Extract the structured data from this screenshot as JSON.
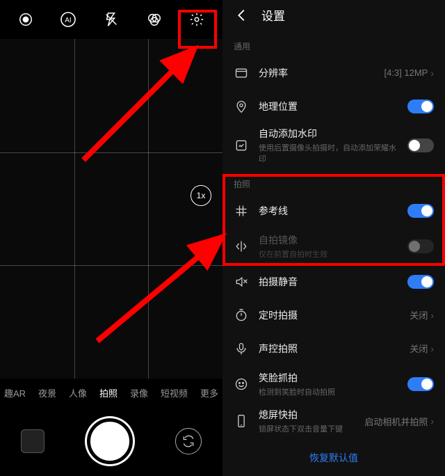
{
  "camera": {
    "zoom_label": "1x",
    "modes": [
      "趣AR",
      "夜景",
      "人像",
      "拍照",
      "录像",
      "短视频",
      "更多"
    ],
    "active_mode_index": 3
  },
  "settings": {
    "title": "设置",
    "sections": {
      "general_label": "通用",
      "photo_label": "拍照"
    },
    "rows": {
      "resolution": {
        "label": "分辨率",
        "value": "[4:3] 12MP"
      },
      "location": {
        "label": "地理位置",
        "on": true
      },
      "watermark": {
        "label": "自动添加水印",
        "sub": "使用后置摄像头拍摄时，自动添加荣耀水印",
        "on": false
      },
      "gridlines": {
        "label": "参考线",
        "on": true
      },
      "mirror": {
        "label": "自拍镜像",
        "sub": "仅在前置自拍时生效",
        "on": false
      },
      "mute": {
        "label": "拍摄静音",
        "on": true
      },
      "timer": {
        "label": "定时拍摄",
        "value": "关闭"
      },
      "voice": {
        "label": "声控拍照",
        "value": "关闭"
      },
      "smile": {
        "label": "笑脸抓拍",
        "sub": "检测到笑脸时自动拍照",
        "on": true
      },
      "quickshot": {
        "label": "熄屏快拍",
        "sub": "锁屏状态下双击音量下键",
        "value": "启动相机并拍照"
      }
    },
    "restore": "恢复默认值"
  }
}
